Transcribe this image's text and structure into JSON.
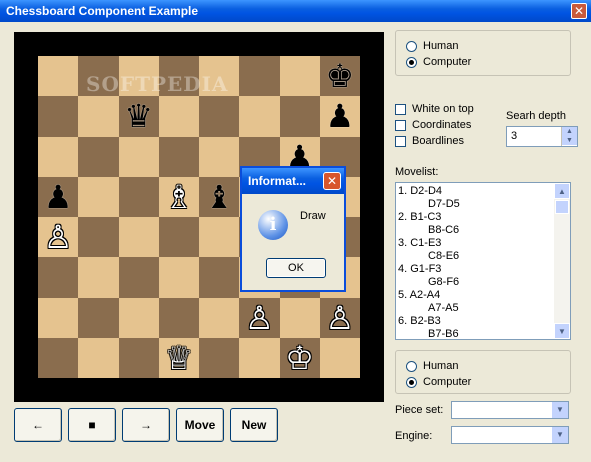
{
  "window": {
    "title": "Chessboard Component Example",
    "close_glyph": "✕"
  },
  "watermark": "SOFTPEDIA",
  "board": {
    "pieces": [
      {
        "square": "h8",
        "glyph": "♚",
        "color": "black",
        "name": "black-king"
      },
      {
        "square": "c7",
        "glyph": "♛",
        "color": "black",
        "name": "black-queen"
      },
      {
        "square": "h7",
        "glyph": "♟",
        "color": "black",
        "name": "black-pawn"
      },
      {
        "square": "g6",
        "glyph": "♟",
        "color": "black",
        "name": "black-pawn"
      },
      {
        "square": "a5",
        "glyph": "♟",
        "color": "black",
        "name": "black-pawn"
      },
      {
        "square": "e5",
        "glyph": "♝",
        "color": "black",
        "name": "black-bishop"
      },
      {
        "square": "d5",
        "glyph": "♗",
        "color": "white",
        "name": "white-bishop"
      },
      {
        "square": "a4",
        "glyph": "♙",
        "color": "white",
        "name": "white-pawn"
      },
      {
        "square": "f2",
        "glyph": "♙",
        "color": "white",
        "name": "white-pawn"
      },
      {
        "square": "h2",
        "glyph": "♙",
        "color": "white",
        "name": "white-pawn"
      },
      {
        "square": "d1",
        "glyph": "♕",
        "color": "white",
        "name": "white-queen"
      },
      {
        "square": "g1",
        "glyph": "♔",
        "color": "white",
        "name": "white-king"
      }
    ]
  },
  "dialog": {
    "title": "Informat...",
    "close_glyph": "✕",
    "icon": "info-icon",
    "icon_glyph": "i",
    "message": "Draw",
    "ok_label": "OK"
  },
  "buttons": {
    "back_glyph": "←",
    "stop_glyph": "■",
    "forward_glyph": "→",
    "move_label": "Move",
    "new_label": "New"
  },
  "top_player": {
    "options": [
      "Human",
      "Computer"
    ],
    "selected": "Computer"
  },
  "bottom_player": {
    "options": [
      "Human",
      "Computer"
    ],
    "selected": "Computer"
  },
  "checks": {
    "white_on_top": "White on top",
    "coordinates": "Coordinates",
    "boardlines": "Boardlines"
  },
  "search": {
    "label": "Searh depth",
    "value": "3"
  },
  "movelist": {
    "label": "Movelist:",
    "moves": [
      {
        "white": "1. D2-D4",
        "black": "D7-D5"
      },
      {
        "white": "2. B1-C3",
        "black": "B8-C6"
      },
      {
        "white": "3. C1-E3",
        "black": "C8-E6"
      },
      {
        "white": "4. G1-F3",
        "black": "G8-F6"
      },
      {
        "white": "5. A2-A4",
        "black": "A7-A5"
      },
      {
        "white": "6. B2-B3",
        "black": "B7-B6"
      }
    ]
  },
  "piece_set": {
    "label": "Piece set:",
    "value": ""
  },
  "engine": {
    "label": "Engine:",
    "value": ""
  },
  "colors": {
    "light_square": "#e5c38f",
    "dark_square": "#8a6d4e",
    "title_blue": "#0054e3"
  }
}
